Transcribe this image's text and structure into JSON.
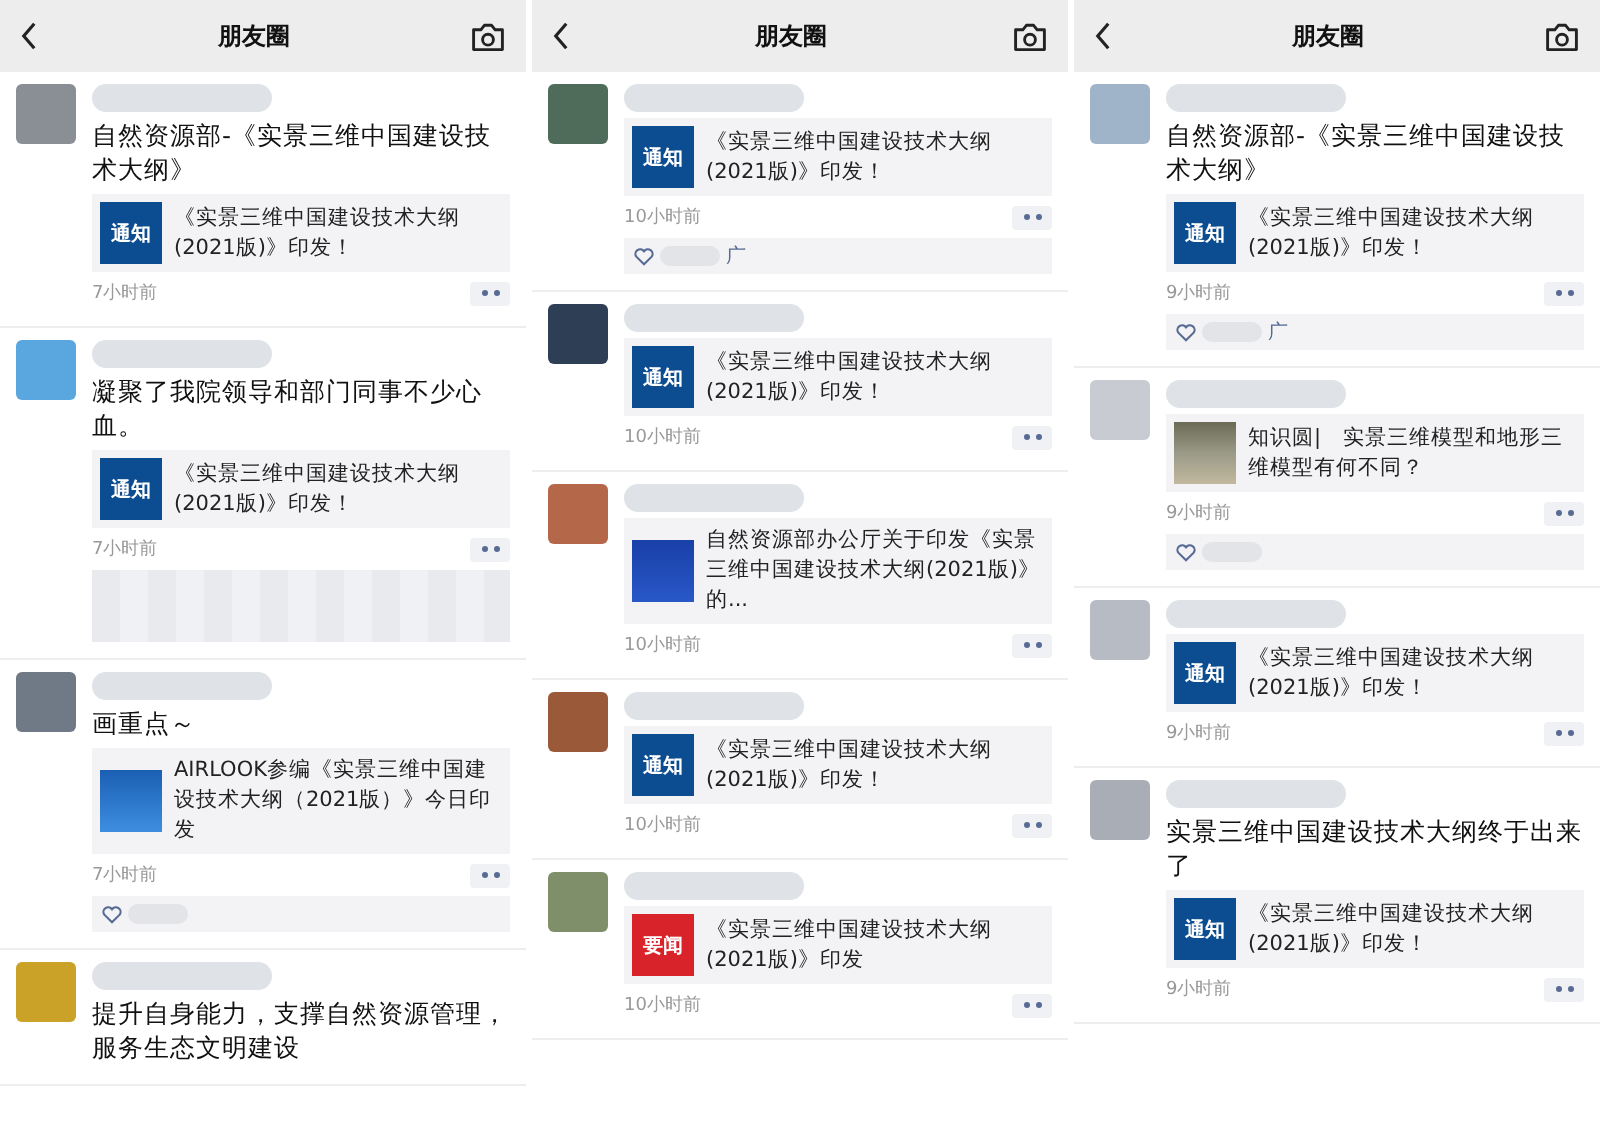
{
  "panels": [
    {
      "title": "朋友圈",
      "posts": [
        {
          "color": "#8a8f96",
          "text": "自然资源部-《实景三维中国建设技术大纲》",
          "card": {
            "kind": "notice",
            "thumb_label": "通知",
            "text": "《实景三维中国建设技术大纲(2021版)》印发！"
          },
          "time": "7小时前"
        },
        {
          "color": "#5aa7e0",
          "text": "凝聚了我院领导和部门同事不少心血。",
          "card": {
            "kind": "notice",
            "thumb_label": "通知",
            "text": "《实景三维中国建设技术大纲(2021版)》印发！"
          },
          "time": "7小时前",
          "extras": [
            {
              "kind": "blurred-comment"
            }
          ]
        },
        {
          "color": "#6f7a86",
          "text": "画重点～",
          "card": {
            "kind": "banner",
            "text": "AIRLOOK参编《实景三维中国建设技术大纲（2021版）》今日印发"
          },
          "time": "7小时前",
          "extras": [
            {
              "kind": "likes"
            }
          ]
        },
        {
          "color": "#c9a227",
          "text": "提升自身能力，支撑自然资源管理，服务生态文明建设"
        }
      ]
    },
    {
      "title": "朋友圈",
      "posts": [
        {
          "color": "#4f6b5a",
          "card": {
            "kind": "notice",
            "thumb_label": "通知",
            "text": "《实景三维中国建设技术大纲(2021版)》印发！"
          },
          "time": "10小时前",
          "extras": [
            {
              "kind": "likes",
              "text": "广"
            }
          ]
        },
        {
          "color": "#2e3f55",
          "card": {
            "kind": "notice",
            "thumb_label": "通知",
            "text": "《实景三维中国建设技术大纲(2021版)》印发！"
          },
          "time": "10小时前"
        },
        {
          "color": "#b5674a",
          "card": {
            "kind": "document",
            "text": "自然资源部办公厅关于印发《实景三维中国建设技术大纲(2021版)》的..."
          },
          "time": "10小时前"
        },
        {
          "color": "#9a5a3a",
          "card": {
            "kind": "notice",
            "thumb_label": "通知",
            "text": "《实景三维中国建设技术大纲(2021版)》印发！"
          },
          "time": "10小时前"
        },
        {
          "color": "#7f8f6a",
          "card": {
            "kind": "news",
            "thumb_label": "要闻",
            "text": "《实景三维中国建设技术大纲(2021版)》印发"
          },
          "time": "10小时前"
        }
      ]
    },
    {
      "title": "朋友圈",
      "posts": [
        {
          "color": "#9fb4c8",
          "text": "自然资源部-《实景三维中国建设技术大纲》",
          "card": {
            "kind": "notice",
            "thumb_label": "通知",
            "text": "《实景三维中国建设技术大纲(2021版)》印发！"
          },
          "time": "9小时前",
          "extras": [
            {
              "kind": "likes",
              "text": "广"
            }
          ]
        },
        {
          "color": "#c8ccd2",
          "card": {
            "kind": "terrain",
            "text": "知识圆|　实景三维模型和地形三维模型有何不同？"
          },
          "time": "9小时前",
          "extras": [
            {
              "kind": "likes"
            }
          ]
        },
        {
          "color": "#b7bcc4",
          "card": {
            "kind": "notice",
            "thumb_label": "通知",
            "text": "《实景三维中国建设技术大纲(2021版)》印发！"
          },
          "time": "9小时前"
        },
        {
          "color": "#a9aeb6",
          "text": "实景三维中国建设技术大纲终于出来了",
          "card": {
            "kind": "notice",
            "thumb_label": "通知",
            "text": "《实景三维中国建设技术大纲(2021版)》印发！"
          },
          "time": "9小时前"
        }
      ]
    }
  ]
}
